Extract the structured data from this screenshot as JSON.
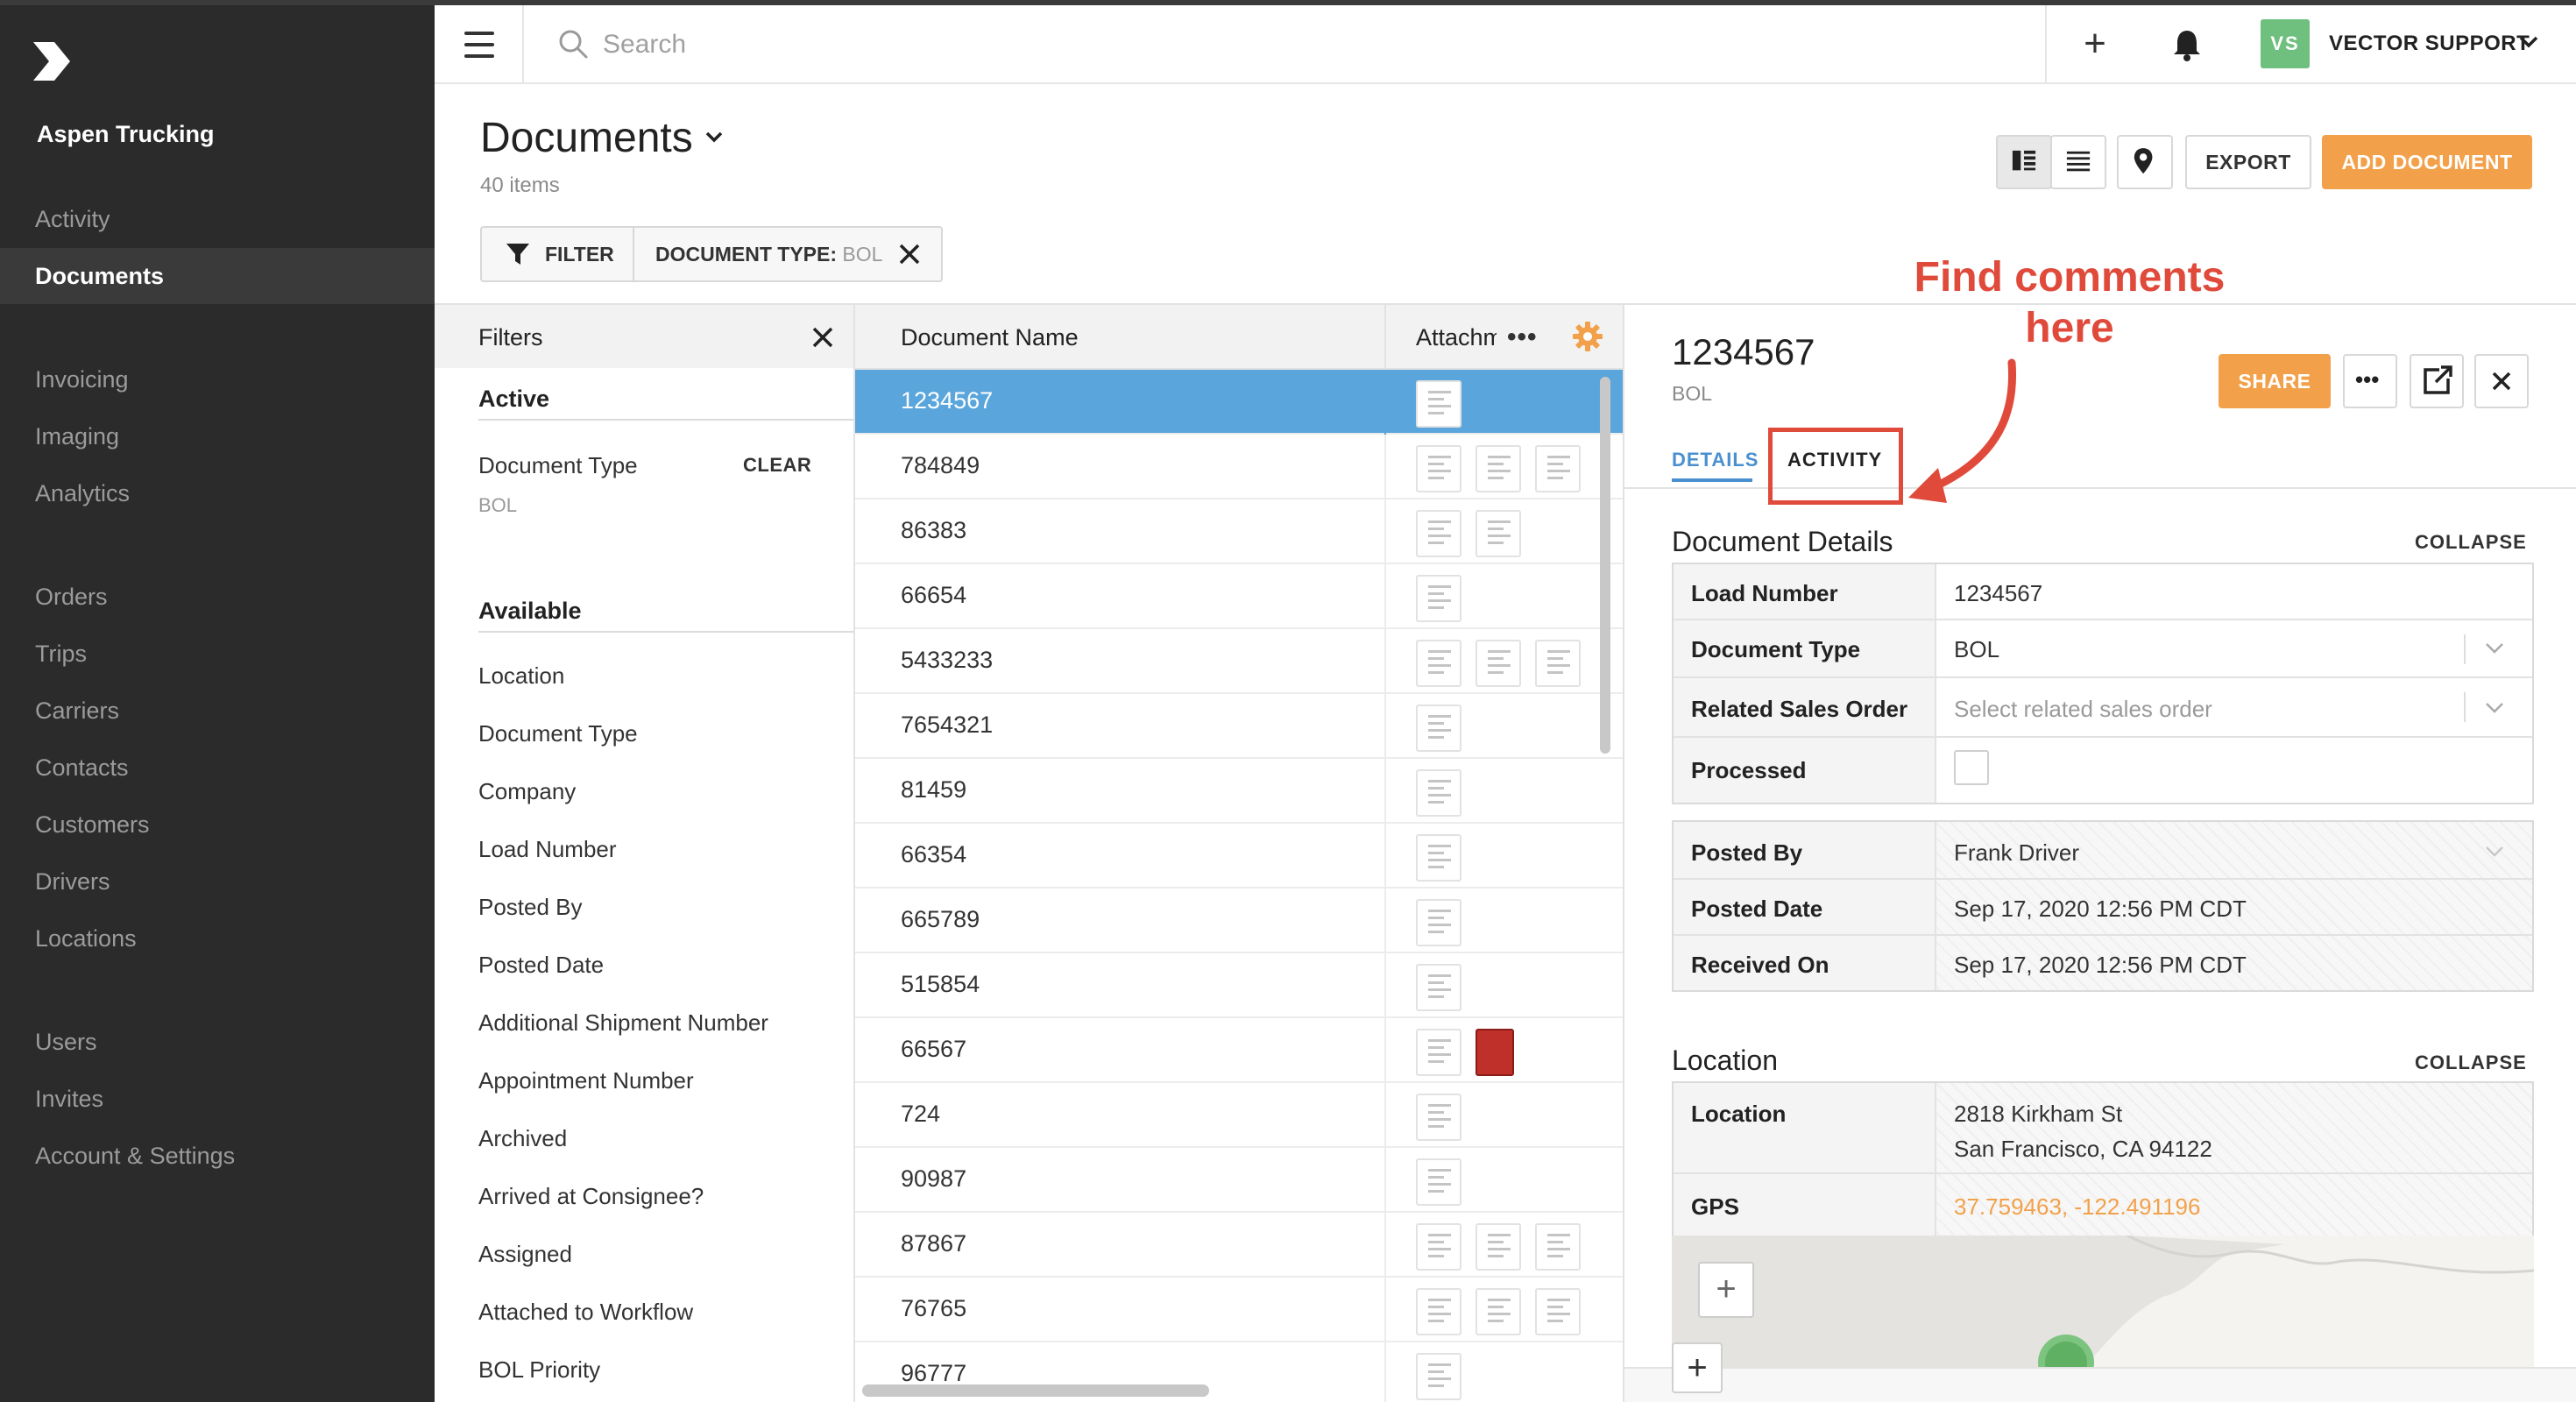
{
  "app": {
    "org_name": "Aspen Trucking",
    "logo_icon": "vector-logo-icon"
  },
  "sidebar": {
    "items": [
      {
        "label": "Activity",
        "active": false
      },
      {
        "label": "Documents",
        "active": true
      },
      {
        "label": "Invoicing",
        "active": false
      },
      {
        "label": "Imaging",
        "active": false
      },
      {
        "label": "Analytics",
        "active": false
      },
      {
        "label": "Orders",
        "active": false
      },
      {
        "label": "Trips",
        "active": false
      },
      {
        "label": "Carriers",
        "active": false
      },
      {
        "label": "Contacts",
        "active": false
      },
      {
        "label": "Customers",
        "active": false
      },
      {
        "label": "Drivers",
        "active": false
      },
      {
        "label": "Locations",
        "active": false
      },
      {
        "label": "Users",
        "active": false
      },
      {
        "label": "Invites",
        "active": false
      },
      {
        "label": "Account & Settings",
        "active": false
      }
    ]
  },
  "topbar": {
    "search_placeholder": "Search",
    "user_initials": "VS",
    "user_name": "VECTOR SUPPORT",
    "avatar_color": "#6fbf7e"
  },
  "page": {
    "title": "Documents",
    "count": "40 items",
    "export_label": "EXPORT",
    "add_label": "ADD DOCUMENT",
    "filter_label": "FILTER",
    "chip_key": "DOCUMENT TYPE:",
    "chip_value": "BOL",
    "accent_color": "#f2a14a"
  },
  "filters": {
    "title": "Filters",
    "active_title": "Active",
    "active_label": "Document Type",
    "clear_label": "CLEAR",
    "active_value": "BOL",
    "available_title": "Available",
    "available": [
      "Location",
      "Document Type",
      "Company",
      "Load Number",
      "Posted By",
      "Posted Date",
      "Additional Shipment Number",
      "Appointment Number",
      "Archived",
      "Arrived at Consignee?",
      "Assigned",
      "Attached to Workflow",
      "BOL Priority"
    ]
  },
  "list": {
    "col_name": "Document Name",
    "col_attachments": "Attachments",
    "rows": [
      {
        "name": "1234567",
        "thumbs": 1,
        "pdf": false
      },
      {
        "name": "784849",
        "thumbs": 3,
        "pdf": false
      },
      {
        "name": "86383",
        "thumbs": 2,
        "pdf": false
      },
      {
        "name": "66654",
        "thumbs": 1,
        "pdf": false
      },
      {
        "name": "5433233",
        "thumbs": 3,
        "pdf": false
      },
      {
        "name": "7654321",
        "thumbs": 1,
        "pdf": false
      },
      {
        "name": "81459",
        "thumbs": 1,
        "pdf": false
      },
      {
        "name": "66354",
        "thumbs": 1,
        "pdf": false
      },
      {
        "name": "665789",
        "thumbs": 1,
        "pdf": false
      },
      {
        "name": "515854",
        "thumbs": 1,
        "pdf": false
      },
      {
        "name": "66567",
        "thumbs": 1,
        "pdf": true
      },
      {
        "name": "724",
        "thumbs": 1,
        "pdf": false
      },
      {
        "name": "90987",
        "thumbs": 1,
        "pdf": false
      },
      {
        "name": "87867",
        "thumbs": 3,
        "pdf": false
      },
      {
        "name": "76765",
        "thumbs": 3,
        "pdf": false
      },
      {
        "name": "96777",
        "thumbs": 1,
        "pdf": false
      }
    ]
  },
  "detail": {
    "title": "1234567",
    "subtitle": "BOL",
    "share_label": "SHARE",
    "tabs": [
      "DETAILS",
      "ACTIVITY"
    ],
    "callout": "Find comments here",
    "section1": "Document Details",
    "collapse": "COLLAPSE",
    "fields": {
      "load_number_label": "Load Number",
      "load_number": "1234567",
      "doc_type_label": "Document Type",
      "doc_type": "BOL",
      "sales_order_label": "Related Sales Order",
      "sales_order_placeholder": "Select related sales order",
      "processed_label": "Processed",
      "posted_by_label": "Posted By",
      "posted_by": "Frank Driver",
      "posted_date_label": "Posted Date",
      "posted_date": "Sep 17, 2020 12:56 PM CDT",
      "received_label": "Received On",
      "received": "Sep 17, 2020 12:56 PM CDT"
    },
    "section2": "Location",
    "location_label": "Location",
    "address_line1": "2818 Kirkham St",
    "address_line2": "San Francisco, CA 94122",
    "gps_label": "GPS",
    "gps": "37.759463, -122.491196"
  }
}
